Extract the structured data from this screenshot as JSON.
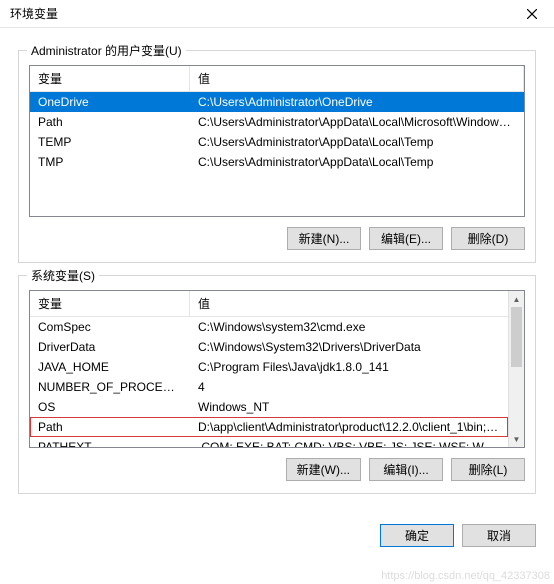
{
  "window": {
    "title": "环境变量"
  },
  "user_vars": {
    "group_label": "Administrator 的用户变量(U)",
    "headers": {
      "name": "变量",
      "value": "值"
    },
    "rows": [
      {
        "name": "OneDrive",
        "value": "C:\\Users\\Administrator\\OneDrive",
        "selected": true
      },
      {
        "name": "Path",
        "value": "C:\\Users\\Administrator\\AppData\\Local\\Microsoft\\WindowsA..."
      },
      {
        "name": "TEMP",
        "value": "C:\\Users\\Administrator\\AppData\\Local\\Temp"
      },
      {
        "name": "TMP",
        "value": "C:\\Users\\Administrator\\AppData\\Local\\Temp"
      }
    ],
    "buttons": {
      "new": "新建(N)...",
      "edit": "编辑(E)...",
      "delete": "删除(D)"
    }
  },
  "system_vars": {
    "group_label": "系统变量(S)",
    "headers": {
      "name": "变量",
      "value": "值"
    },
    "rows": [
      {
        "name": "ComSpec",
        "value": "C:\\Windows\\system32\\cmd.exe"
      },
      {
        "name": "DriverData",
        "value": "C:\\Windows\\System32\\Drivers\\DriverData"
      },
      {
        "name": "JAVA_HOME",
        "value": "C:\\Program Files\\Java\\jdk1.8.0_141"
      },
      {
        "name": "NUMBER_OF_PROCESSORS",
        "value": "4"
      },
      {
        "name": "OS",
        "value": "Windows_NT"
      },
      {
        "name": "Path",
        "value": "D:\\app\\client\\Administrator\\product\\12.2.0\\client_1\\bin;D:\\ap...",
        "highlighted": true
      },
      {
        "name": "PATHEXT",
        "value": ".COM;.EXE;.BAT;.CMD;.VBS;.VBE;.JS;.JSE;.WSF;.WSH;.MSC"
      }
    ],
    "buttons": {
      "new": "新建(W)...",
      "edit": "编辑(I)...",
      "delete": "删除(L)"
    }
  },
  "dialog": {
    "ok": "确定",
    "cancel": "取消"
  },
  "watermark": "https://blog.csdn.net/qq_42337308"
}
